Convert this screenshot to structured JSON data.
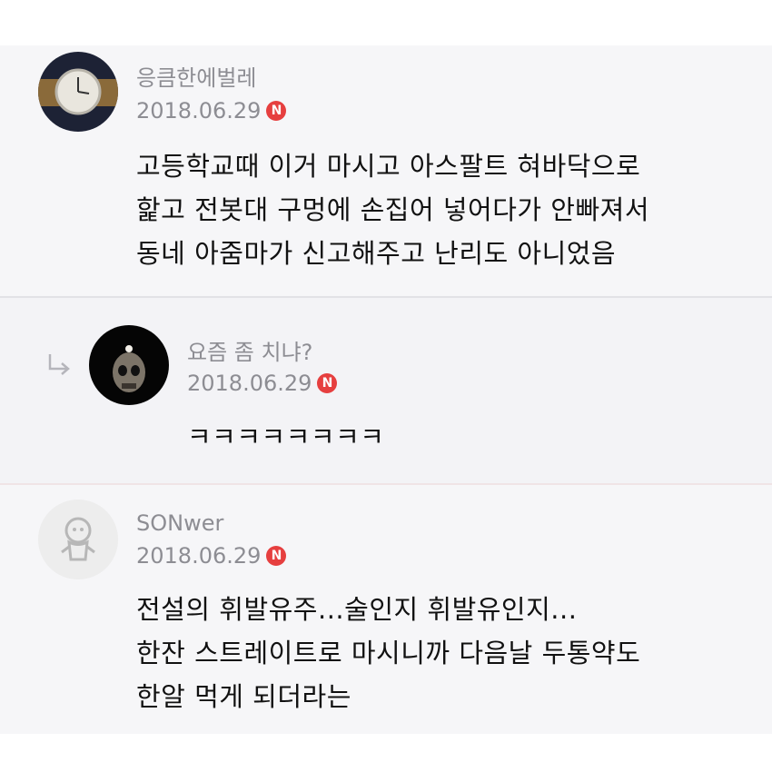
{
  "comments": [
    {
      "nickname": "응큼한에벌레",
      "date": "2018.06.29",
      "badge": "N",
      "avatar": "wristwatch-avatar",
      "lines": [
        "고등학교때 이거 마시고 아스팔트 혀바닥으로",
        "핥고 전봇대 구멍에 손집어 넣어다가 안빠져서",
        "동네 아줌마가 신고해주고 난리도 아니었음"
      ]
    },
    {
      "nickname": "요즘 좀 치냐?",
      "date": "2018.06.29",
      "badge": "N",
      "avatar": "skull-avatar",
      "is_reply": true,
      "lines": [
        "ㅋㅋㅋㅋㅋㅋㅋㅋ"
      ]
    },
    {
      "nickname": "SONwer",
      "date": "2018.06.29",
      "badge": "N",
      "avatar": "default-character-avatar",
      "lines": [
        "전설의 휘발유주...술인지 휘발유인지...",
        "한잔 스트레이트로 마시니까 다음날 두통약도",
        "한알 먹게 되더라는"
      ]
    }
  ],
  "colors": {
    "badge": "#e63f3f",
    "meta_text": "#8d8d93",
    "body_text": "#111111",
    "background": "#f6f6f8"
  }
}
